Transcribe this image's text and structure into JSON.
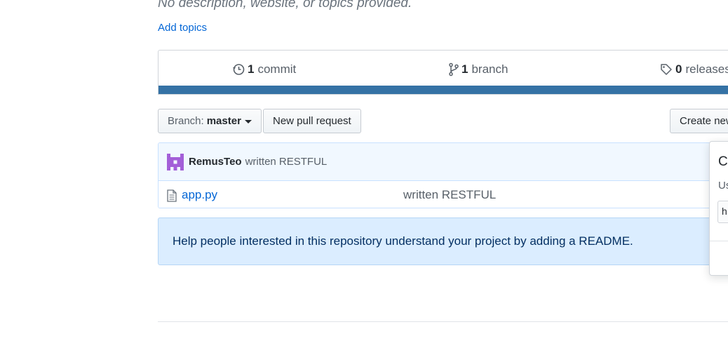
{
  "repo": {
    "description": "No description, website, or topics provided.",
    "add_topics": "Add topics"
  },
  "summary": {
    "commits": {
      "count": "1",
      "label": "commit",
      "icon": "history-icon"
    },
    "branches": {
      "count": "1",
      "label": "branch",
      "icon": "git-branch-icon"
    },
    "releases": {
      "count": "0",
      "label": "releases",
      "icon": "tag-icon"
    },
    "language_bar_color": "#3572a5"
  },
  "toolbar": {
    "branch_prefix": "Branch:",
    "branch_name": "master",
    "new_pull_request": "New pull request",
    "create_new": "Create new"
  },
  "latest_commit": {
    "author": "RemusTeo",
    "message": "written RESTFUL"
  },
  "files": [
    {
      "name": "app.py",
      "message": "written RESTFUL",
      "icon": "file-icon"
    }
  ],
  "readme_notice": "Help people interested in this repository understand your project by adding a README.",
  "clone_popup": {
    "title": "Cl",
    "subtitle": "Us",
    "input_value": "h"
  },
  "colors": {
    "link": "#0366d6",
    "notice_bg": "#dbedff",
    "tease_bg": "#f1f8ff",
    "avatar": "#a35fd8"
  }
}
